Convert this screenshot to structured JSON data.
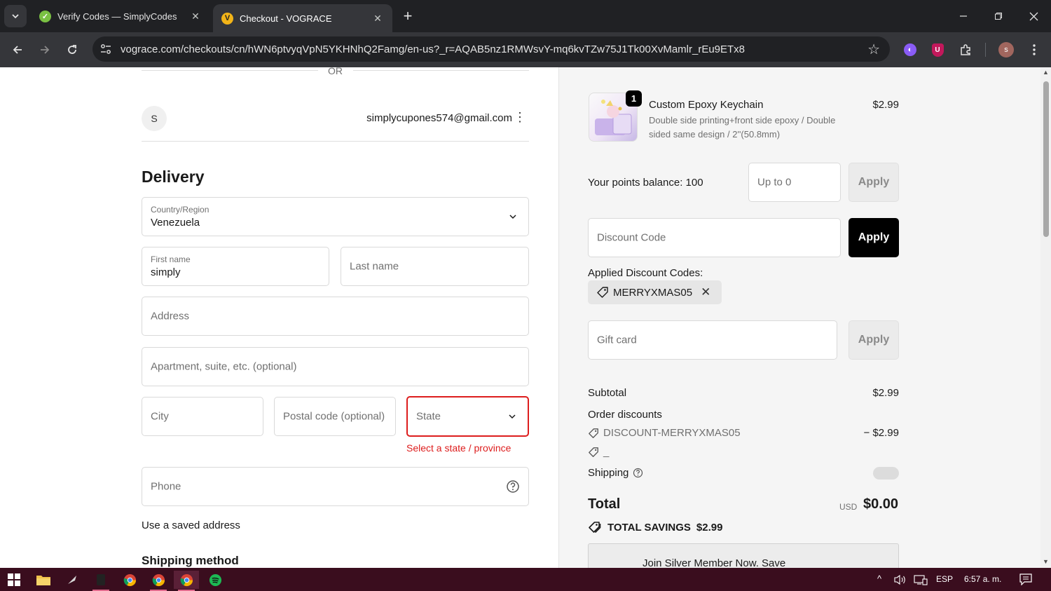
{
  "browser": {
    "tabs": [
      {
        "title": "Verify Codes — SimplyCodes",
        "icon": "simplycodes-icon"
      },
      {
        "title": "Checkout - VOGRACE",
        "icon": "vograce-icon"
      }
    ],
    "url": "vograce.com/checkouts/cn/hWN6ptvyqVpN5YKHNhQ2Famg/en-us?_r=AQAB5nz1RMWsvY-mq6kvTZw75J1Tk00XvMamlr_rEu9ETx8",
    "profile_initial": "s"
  },
  "checkout": {
    "or_divider": "OR",
    "account": {
      "initial": "S",
      "email": "simplycupones574@gmail.com"
    },
    "delivery_heading": "Delivery",
    "country": {
      "label": "Country/Region",
      "value": "Venezuela"
    },
    "first_name": {
      "label": "First name",
      "value": "simply"
    },
    "last_name_placeholder": "Last name",
    "address_placeholder": "Address",
    "apartment_placeholder": "Apartment, suite, etc. (optional)",
    "city_placeholder": "City",
    "postal_placeholder": "Postal code (optional)",
    "state_placeholder": "State",
    "state_error": "Select a state / province",
    "phone_placeholder": "Phone",
    "saved_address_link": "Use a saved address",
    "shipping_method_heading": "Shipping method"
  },
  "summary": {
    "product": {
      "quantity": "1",
      "name": "Custom Epoxy Keychain",
      "variant": "Double side printing+front side epoxy / Double sided same design / 2''(50.8mm)",
      "price": "$2.99"
    },
    "points_label": "Your points balance: 100",
    "points_placeholder": "Up to 0",
    "points_apply": "Apply",
    "discount_placeholder": "Discount Code",
    "discount_apply": "Apply",
    "applied_codes_label": "Applied Discount Codes:",
    "applied_code": "MERRYXMAS05",
    "giftcard_placeholder": "Gift card",
    "giftcard_apply": "Apply",
    "subtotal_label": "Subtotal",
    "subtotal_value": "$2.99",
    "order_discounts_label": "Order discounts",
    "discount_line_code": "DISCOUNT-MERRYXMAS05",
    "discount_line_value": "− $2.99",
    "discount_line_2": "_",
    "shipping_label": "Shipping",
    "total_label": "Total",
    "total_currency": "USD",
    "total_value": "$0.00",
    "savings_label": "TOTAL SAVINGS",
    "savings_value": "$2.99",
    "member_cta": "Join Silver Member Now. Save"
  },
  "taskbar": {
    "language": "ESP",
    "time": "6:57 a. m."
  },
  "colors": {
    "error": "#dd1d1d",
    "button_dark": "#000000",
    "taskbar": "#3a0d1e"
  }
}
